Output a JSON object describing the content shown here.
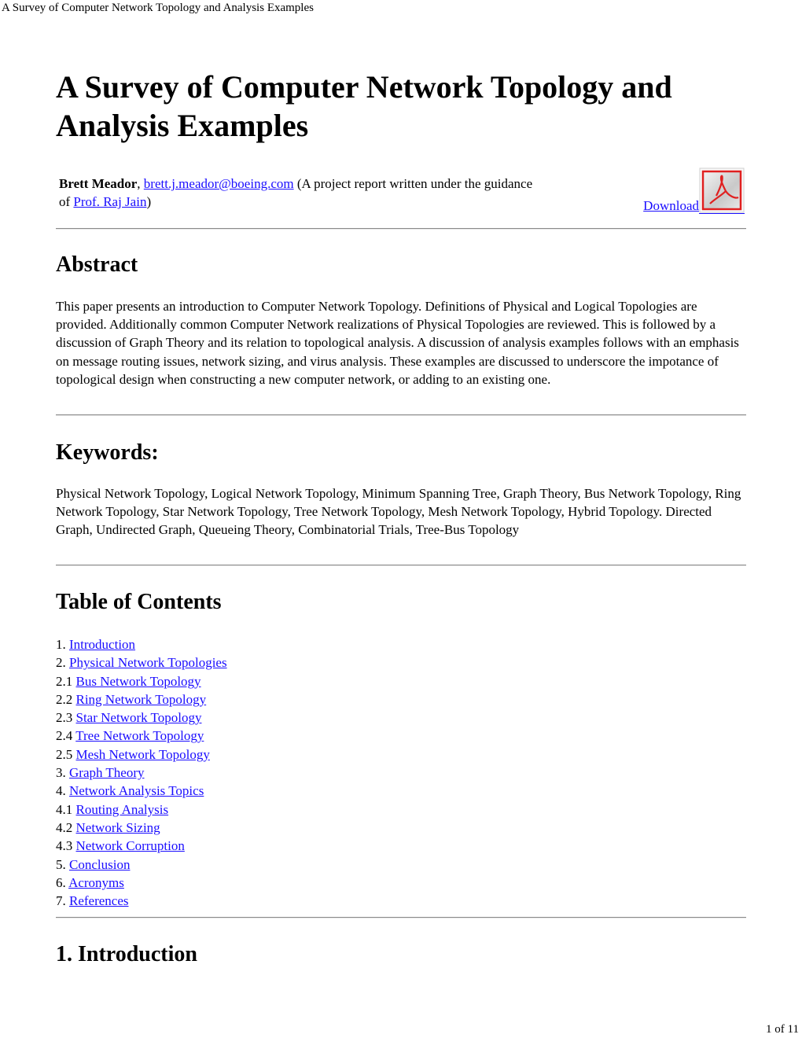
{
  "header": {
    "window_title": "A Survey of Computer Network Topology and Analysis Examples"
  },
  "document": {
    "title": "A Survey of Computer Network Topology and Analysis Examples",
    "author": {
      "name": "Brett Meador",
      "separator": ",",
      "email": "brett.j.meador@boeing.com",
      "note_prefix": "(A project report written under the guidance of",
      "advisor": "Prof. Raj Jain",
      "note_suffix": ")"
    },
    "download": {
      "label": "Download",
      "icon": "pdf-icon"
    },
    "abstract": {
      "heading": "Abstract",
      "text": "This paper presents an introduction to Computer Network Topology. Definitions of Physical and Logical Topologies are provided. Additionally common Computer Network realizations of Physical Topologies are reviewed. This is followed by a discussion of Graph Theory and its relation to topological analysis. A discussion of analysis examples follows with an emphasis on message routing issues, network sizing, and virus analysis. These examples are discussed to underscore the impotance of topological design when constructing a new computer network, or adding to an existing one."
    },
    "keywords": {
      "heading": "Keywords:",
      "text": "Physical Network Topology, Logical Network Topology, Minimum Spanning Tree, Graph Theory, Bus Network Topology, Ring Network Topology, Star Network Topology, Tree Network Topology, Mesh Network Topology, Hybrid Topology. Directed Graph, Undirected Graph, Queueing Theory, Combinatorial Trials, Tree-Bus Topology"
    },
    "toc": {
      "heading": "Table of Contents",
      "items": [
        {
          "num": "1.",
          "label": "Introduction"
        },
        {
          "num": "2.",
          "label": "Physical Network Topologies"
        },
        {
          "num": "2.1",
          "label": "Bus Network Topology"
        },
        {
          "num": "2.2",
          "label": "Ring Network Topology"
        },
        {
          "num": "2.3",
          "label": "Star Network Topology"
        },
        {
          "num": "2.4",
          "label": "Tree Network Topology"
        },
        {
          "num": "2.5",
          "label": "Mesh Network Topology"
        },
        {
          "num": "3.",
          "label": "Graph Theory"
        },
        {
          "num": "4.",
          "label": "Network Analysis Topics"
        },
        {
          "num": "4.1",
          "label": "Routing Analysis"
        },
        {
          "num": "4.2",
          "label": "Network Sizing"
        },
        {
          "num": "4.3",
          "label": "Network Corruption"
        },
        {
          "num": "5.",
          "label": "Conclusion"
        },
        {
          "num": "6.",
          "label": "Acronyms"
        },
        {
          "num": "7.",
          "label": "References"
        }
      ]
    },
    "introduction": {
      "heading": "1. Introduction"
    }
  },
  "footer": {
    "page_indicator": "1 of 11"
  },
  "colors": {
    "link": "#1a0dff",
    "pdf_icon_red": "#e02020"
  }
}
